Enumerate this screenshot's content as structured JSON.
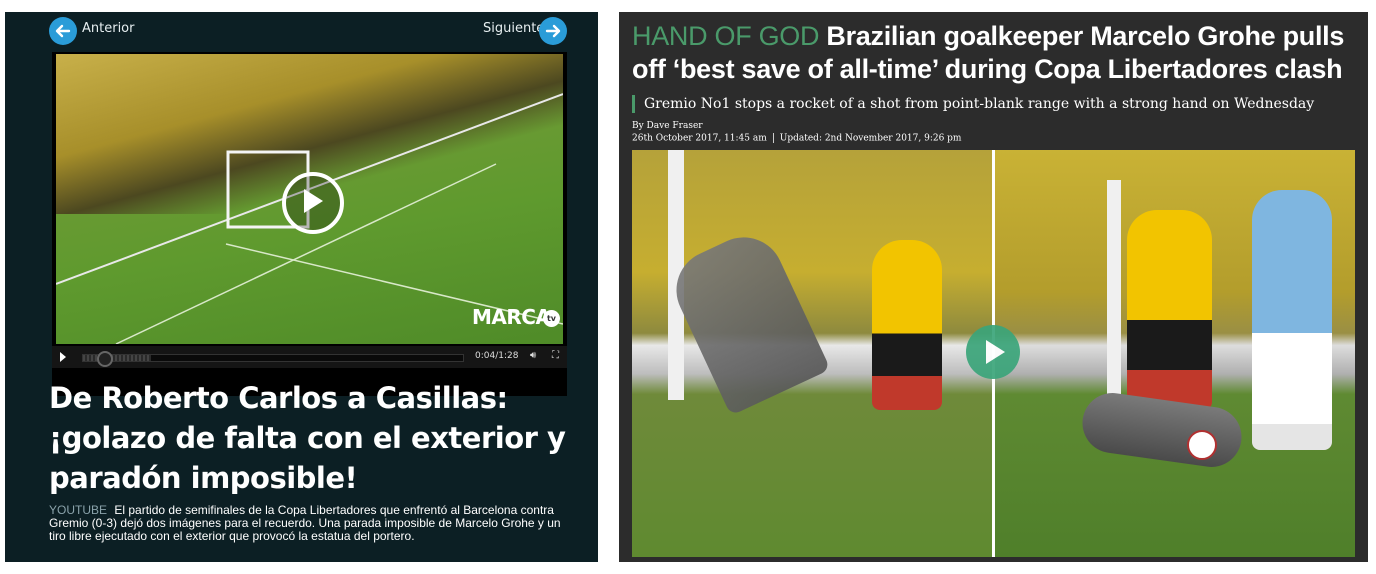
{
  "left_panel": {
    "nav": {
      "prev_label": "Anterior",
      "next_label": "Siguiente"
    },
    "video": {
      "brand": "MARCA",
      "brand_badge": "tv",
      "time": "0:04/1:28",
      "progress_fraction": 0.045
    },
    "title": "De Roberto Carlos a Casillas: ¡golazo de falta con el exterior y paradón imposible!",
    "description": {
      "source_tag": "YOUTUBE",
      "text": "El partido de semifinales de la Copa Libertadores que enfrentó al Barcelona contra Gremio (0-3) dejó dos imágenes para el recuerdo. Una parada imposible de Marcelo Grohe y un tiro libre ejecutado con el exterior que provocó la estatua del portero."
    }
  },
  "right_panel": {
    "kicker": "HAND OF GOD",
    "headline": "Brazilian goalkeeper Marcelo Grohe pulls off ‘best save of all-time’ during Copa Libertadores clash",
    "standfirst": "Gremio No1 stops a rocket of a shot from point-blank range with a strong hand on Wednesday",
    "byline": "By Dave Fraser",
    "published": "26th October 2017, 11:45 am",
    "updated": "Updated: 2nd November 2017, 9:26 pm"
  },
  "colors": {
    "left_bg": "#0c1f24",
    "nav_accent": "#2a9cd8",
    "right_bg": "#2c2c2c",
    "kicker_green": "#4a9a6a",
    "play_green": "#3ba57a"
  },
  "icons": [
    "arrow-left-icon",
    "arrow-right-icon",
    "play-icon",
    "volume-icon",
    "fullscreen-icon"
  ]
}
